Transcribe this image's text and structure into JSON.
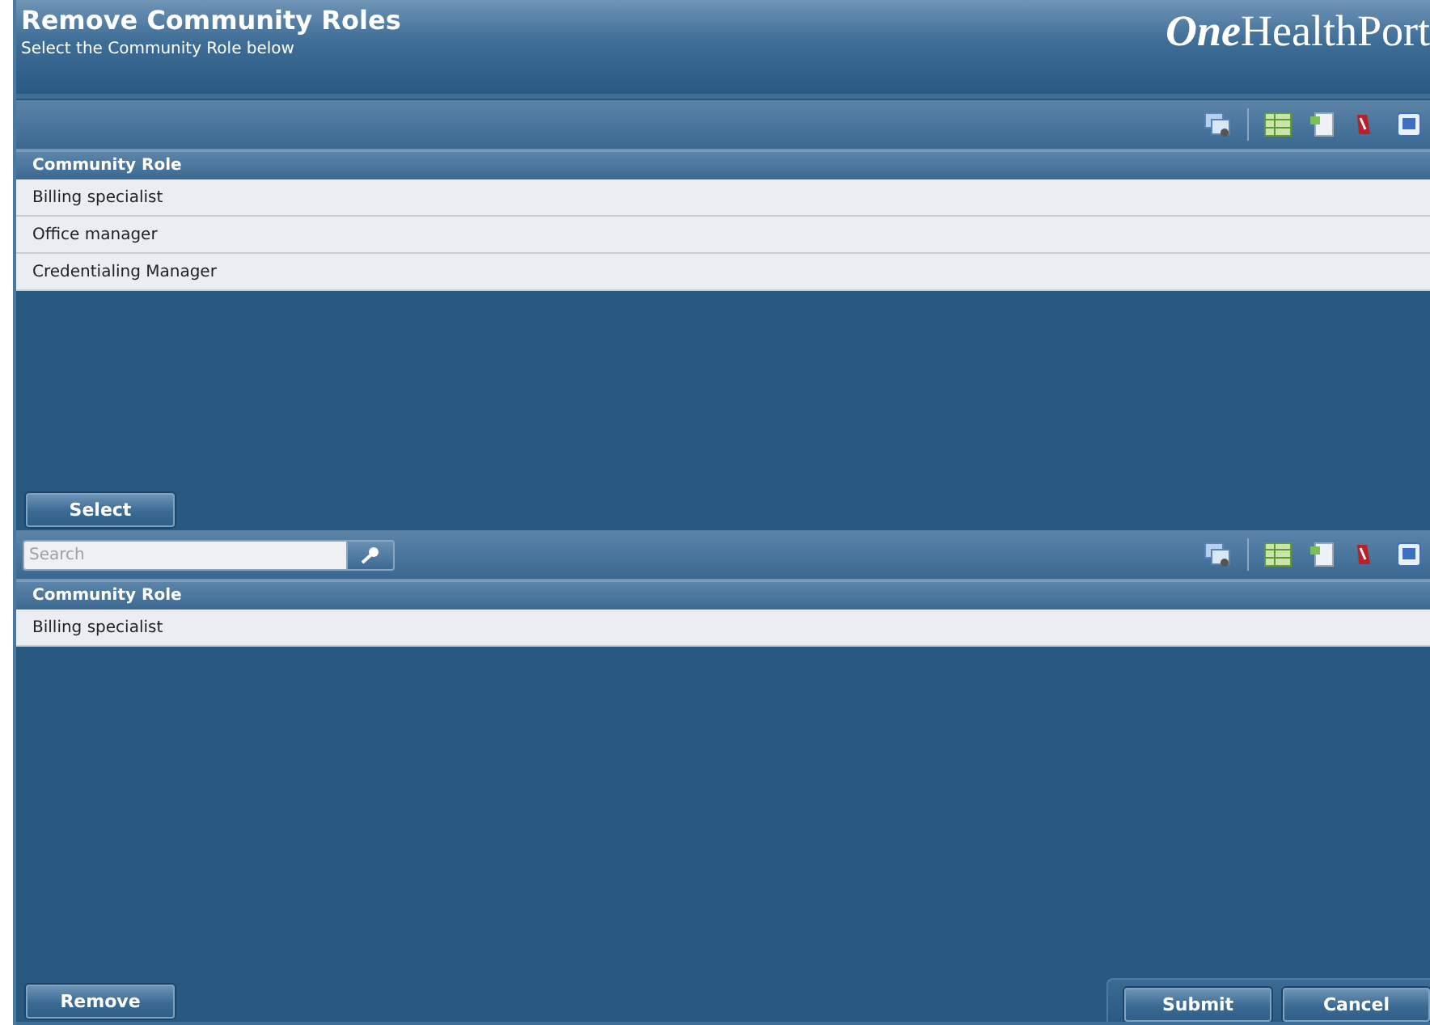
{
  "header": {
    "title": "Remove Community Roles",
    "subtitle": "Select the Community Role below",
    "logo": {
      "emphasis": "One",
      "rest": "HealthPort"
    }
  },
  "grids": [
    {
      "column": "Community Role",
      "rows": [
        "Billing specialist",
        "Office manager",
        "Credentialing Manager"
      ],
      "button": "Select"
    },
    {
      "search": {
        "placeholder": "Search"
      },
      "column": "Community Role",
      "rows": [
        "Billing specialist"
      ],
      "button": "Remove"
    }
  ],
  "footer_buttons": [
    "Submit",
    "Cancel"
  ]
}
